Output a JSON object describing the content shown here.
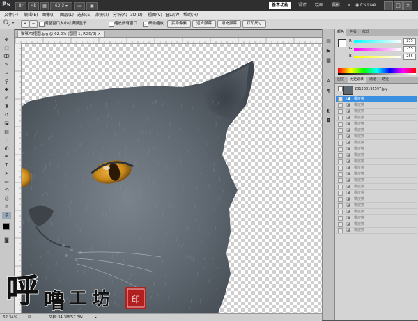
{
  "titlebar": {
    "logo": "Ps",
    "zoom": "62.3",
    "workspaces": [
      "基本功能",
      "设计",
      "绘画",
      "摄影"
    ],
    "more": "»",
    "cs_live": "CS Live"
  },
  "menu": [
    "文件(F)",
    "编辑(E)",
    "图像(I)",
    "图层(L)",
    "选择(S)",
    "滤镜(T)",
    "分析(A)",
    "3D(D)",
    "视图(V)",
    "窗口(W)",
    "帮助(H)"
  ],
  "options": {
    "check1_label": "调整窗口大小以满屏显示",
    "check2_label": "缩放所有窗口",
    "check3_label": "细微缩放",
    "buttons": [
      "实际像素",
      "适合屏幕",
      "填充屏幕",
      "打印尺寸"
    ]
  },
  "document": {
    "tab": "猫咪PS抠图.jpg @ 62.3% (图层 1, RGB/8) ×"
  },
  "status": {
    "zoom": "62.34%",
    "doc": "文档:34.3M/57.3M"
  },
  "color_panel": {
    "tabs": [
      "颜色",
      "色板",
      "样式"
    ],
    "channels": [
      {
        "label": "R",
        "value": "255"
      },
      {
        "label": "G",
        "value": "255"
      },
      {
        "label": "B",
        "value": "255"
      }
    ]
  },
  "history_panel": {
    "tabs": [
      "图层",
      "历史记录",
      "通道",
      "路径"
    ],
    "snapshot": "201208192597.jpg",
    "active_item": "橡皮擦",
    "items": [
      "橡皮擦",
      "橡皮擦",
      "橡皮擦",
      "橡皮擦",
      "橡皮擦",
      "橡皮擦",
      "橡皮擦",
      "橡皮擦",
      "橡皮擦",
      "橡皮擦",
      "橡皮擦",
      "橡皮擦",
      "橡皮擦",
      "橡皮擦",
      "橡皮擦",
      "橡皮擦",
      "橡皮擦",
      "橡皮擦",
      "橡皮擦",
      "橡皮擦",
      "橡皮擦",
      "橡皮擦"
    ]
  },
  "watermark": {
    "text": "呼噜工坊"
  },
  "colors": {
    "active_blue": "#3b8fe0",
    "cat_fur": "#5e6670",
    "eye": "#c8891a"
  }
}
